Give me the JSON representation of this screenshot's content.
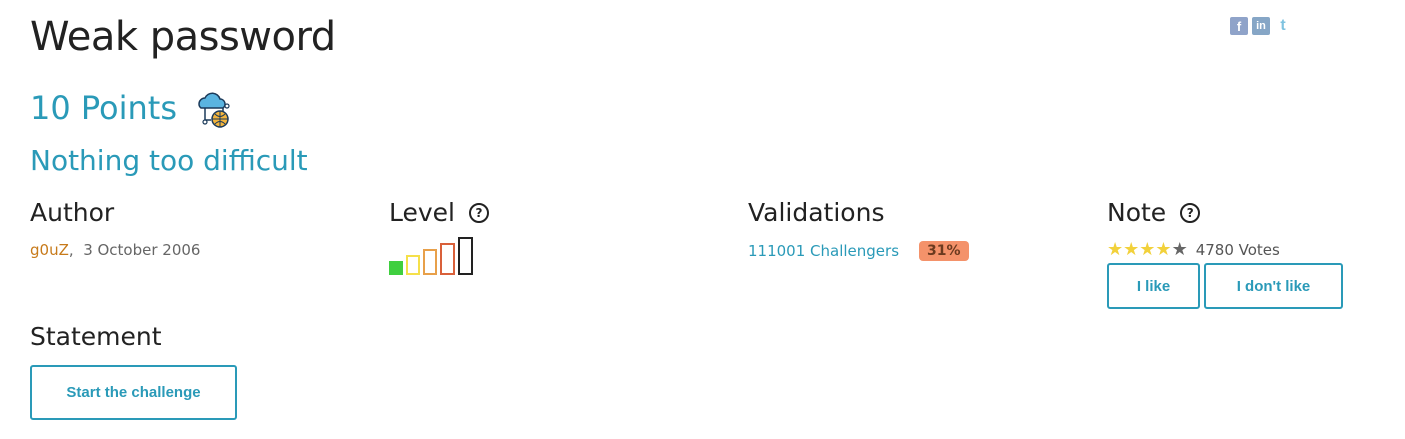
{
  "challenge": {
    "title": "Weak password",
    "points": "10 Points",
    "subtitle": "Nothing too difficult"
  },
  "social": {
    "facebook": "f",
    "linkedin": "in",
    "twitter": "t"
  },
  "author": {
    "heading": "Author",
    "name": "g0uZ",
    "separator": ",",
    "date": "3 October 2006"
  },
  "level": {
    "heading": "Level",
    "help": "?",
    "current": 1,
    "max": 5,
    "colors": [
      "#3fcf3f",
      "#f5e04a",
      "#e8a04a",
      "#d9603a",
      "#222222"
    ]
  },
  "validations": {
    "heading": "Validations",
    "count": "111001 Challengers",
    "percent": "31%"
  },
  "note": {
    "heading": "Note",
    "help": "?",
    "rating": 4,
    "rating_max": 5,
    "votes": "4780 Votes",
    "like_label": "I like",
    "dislike_label": "I don't like"
  },
  "statement": {
    "heading": "Statement",
    "start_label": "Start the challenge"
  }
}
